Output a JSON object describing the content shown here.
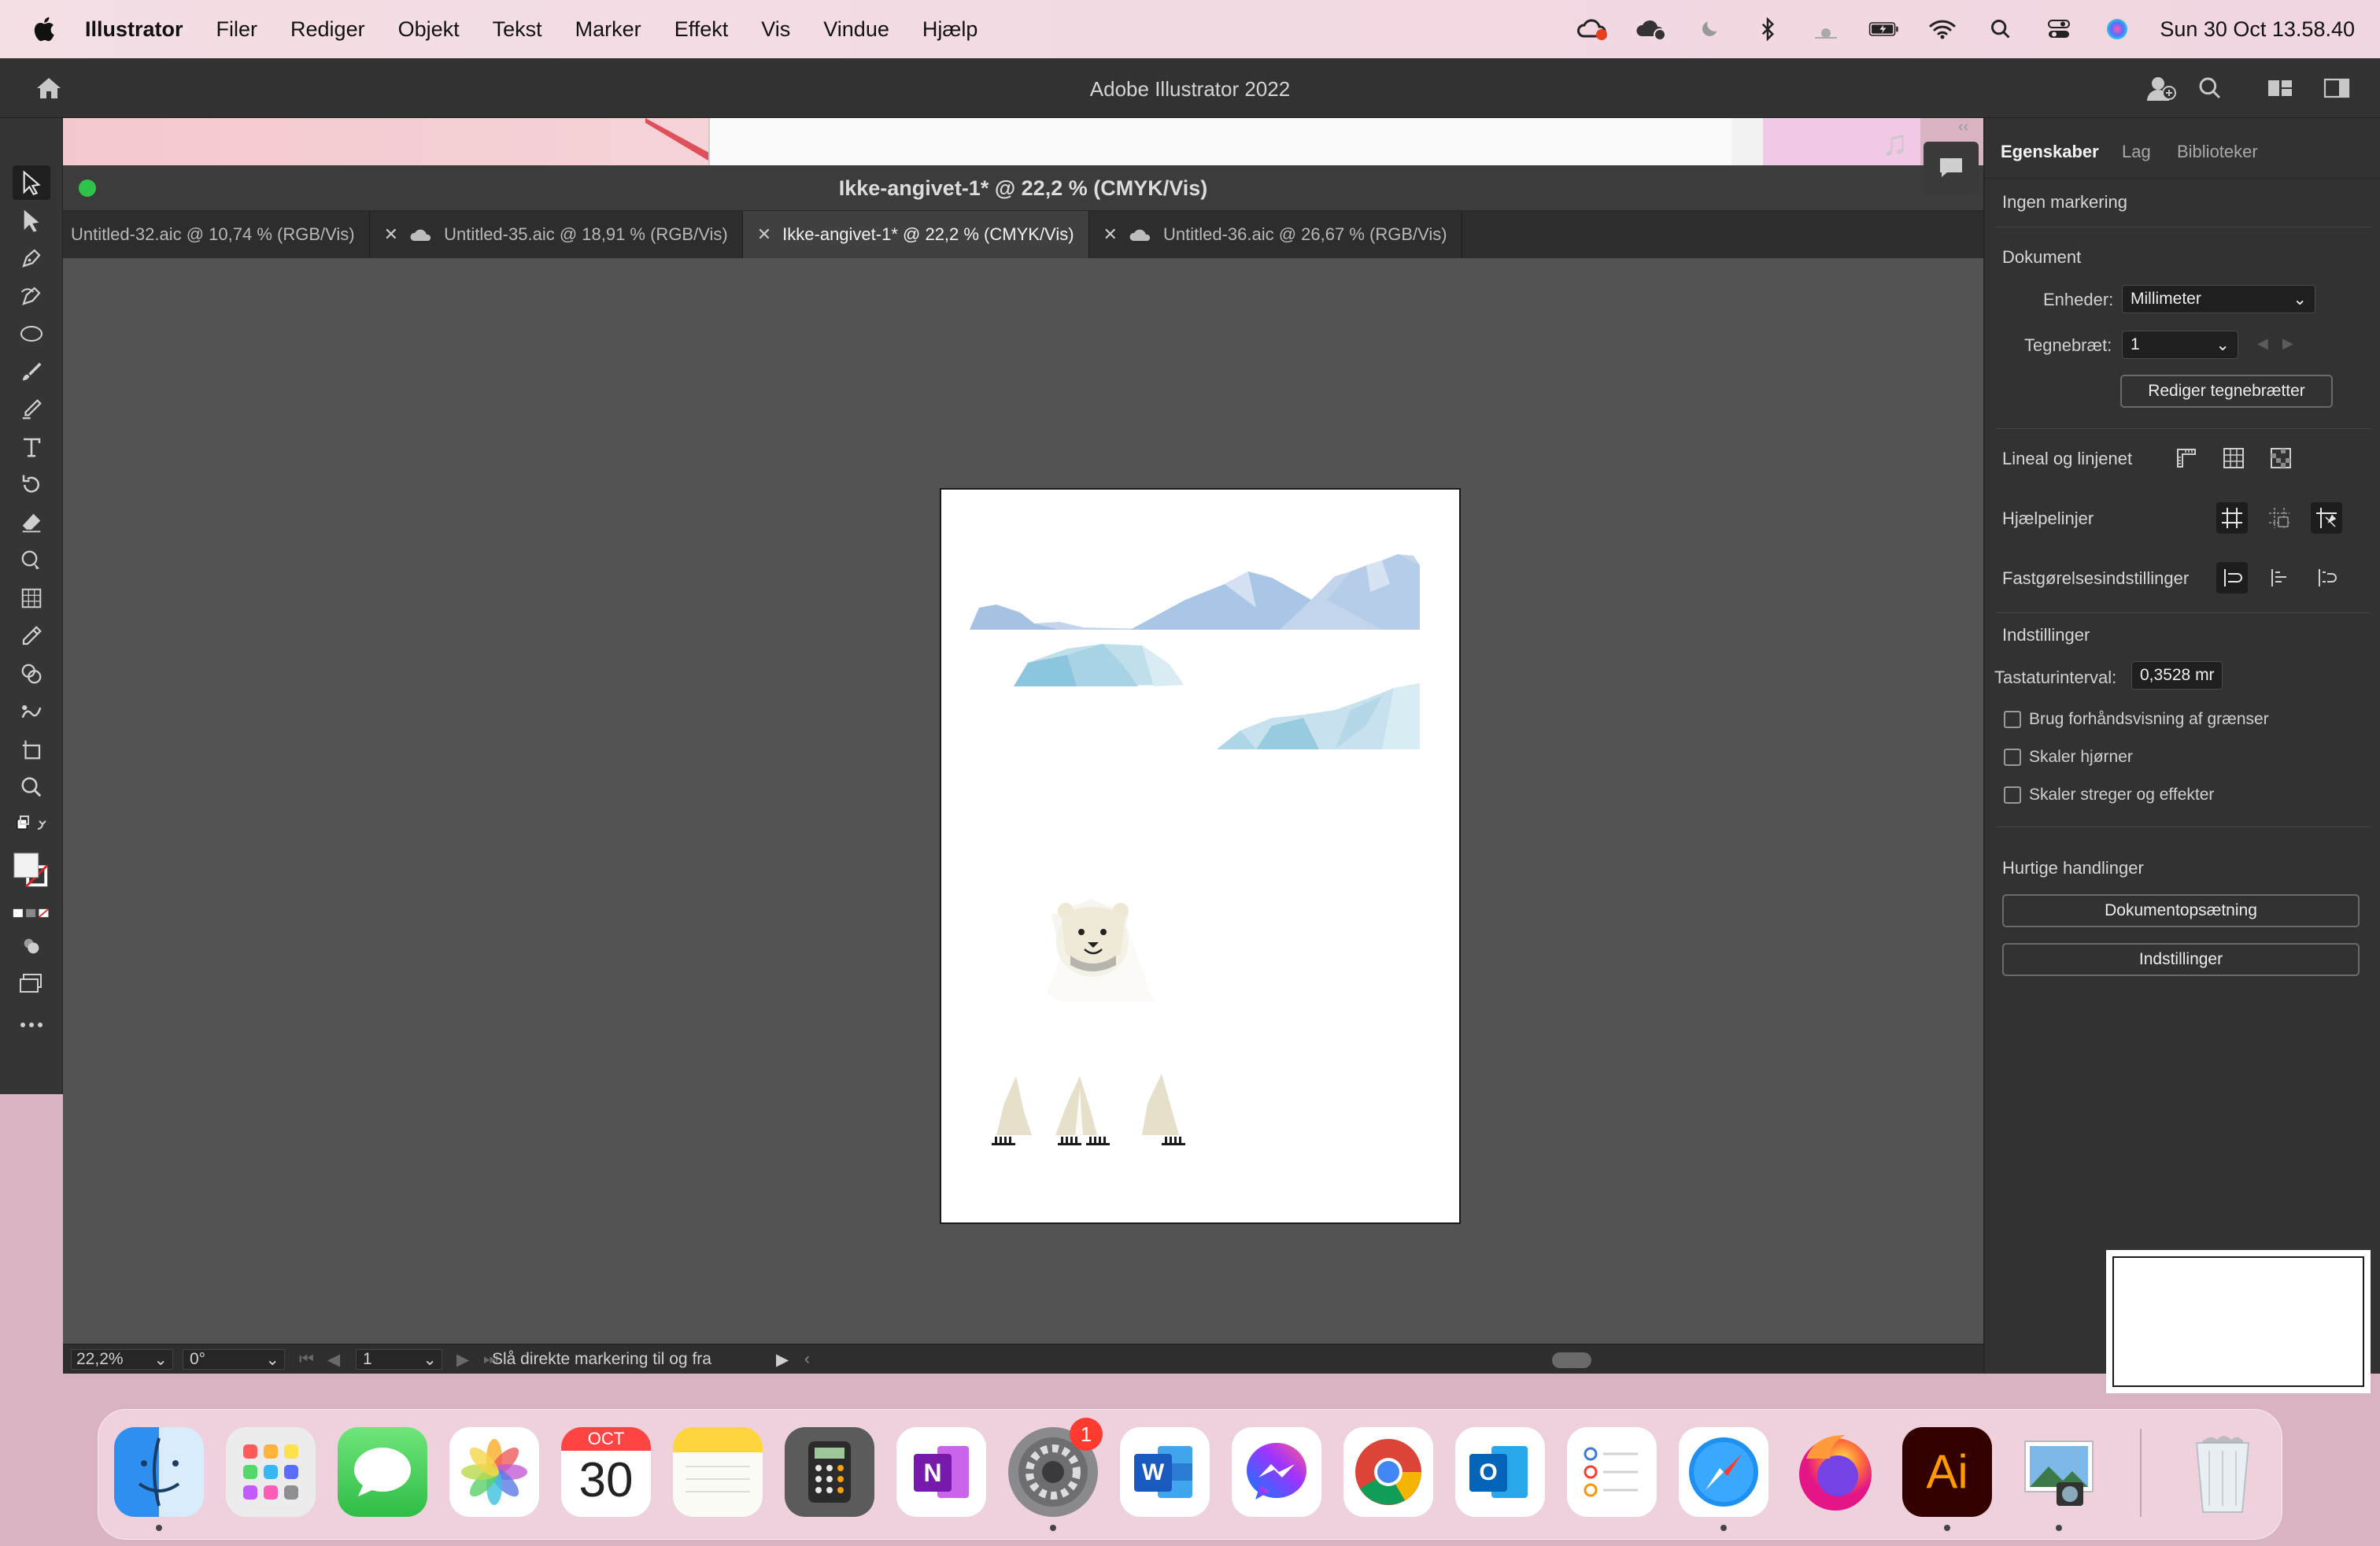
{
  "menubar": {
    "app_name": "Illustrator",
    "items": [
      "Filer",
      "Rediger",
      "Objekt",
      "Tekst",
      "Marker",
      "Effekt",
      "Vis",
      "Vindue",
      "Hjælp"
    ],
    "clock": "Sun 30 Oct  13.58.40"
  },
  "appbar": {
    "title": "Adobe Illustrator 2022"
  },
  "document": {
    "title": "Ikke-angivet-1* @ 22,2 % (CMYK/Vis)",
    "tabs": [
      {
        "label": "Untitled-32.aic @ 10,74 % (RGB/Vis)",
        "cloud": false,
        "active": false
      },
      {
        "label": "Untitled-35.aic @ 18,91 % (RGB/Vis)",
        "cloud": true,
        "active": false
      },
      {
        "label": "Ikke-angivet-1* @ 22,2 % (CMYK/Vis)",
        "cloud": false,
        "active": true
      },
      {
        "label": "Untitled-36.aic @ 26,67 % (RGB/Vis)",
        "cloud": true,
        "active": false
      }
    ]
  },
  "status": {
    "zoom": "22,2%",
    "rotation": "0°",
    "artboard": "1",
    "hint": "Slå direkte markering til og fra"
  },
  "panel": {
    "tabs": [
      "Egenskaber",
      "Lag",
      "Biblioteker"
    ],
    "no_selection": "Ingen markering",
    "document_header": "Dokument",
    "units_label": "Enheder:",
    "units_value": "Millimeter",
    "artboard_label": "Tegnebræt:",
    "artboard_value": "1",
    "edit_artboards": "Rediger tegnebrætter",
    "rulers_label": "Lineal og linjenet",
    "guides_label": "Hjælpelinjer",
    "snap_label": "Fastgørelsesindstillinger",
    "prefs_header": "Indstillinger",
    "keyboard_label": "Tastaturinterval:",
    "keyboard_value": "0,3528 mr",
    "checkboxes": [
      "Brug forhåndsvisning af grænser",
      "Skaler hjørner",
      "Skaler streger og effekter"
    ],
    "quick_header": "Hurtige handlinger",
    "btn_doc_setup": "Dokumentopsætning",
    "btn_prefs": "Indstillinger"
  },
  "dock": {
    "calendar_month": "OCT",
    "calendar_day": "30",
    "settings_badge": "1",
    "ai_label": "Ai",
    "onenote_label": "N",
    "word_label": "W",
    "outlook_label": "O",
    "apps": [
      "Finder",
      "Launchpad",
      "Messages",
      "Photos",
      "Calendar",
      "Notes",
      "Calculator",
      "OneNote",
      "System Preferences",
      "Word",
      "Messenger",
      "Chrome",
      "Outlook",
      "Reminders",
      "Safari",
      "Firefox",
      "Illustrator",
      "Preview",
      "Trash"
    ]
  },
  "colors": {
    "menubar_bg": "#f3dde4",
    "app_chrome": "#323232",
    "canvas": "#535353",
    "ice_blue": "#a9c8e6",
    "ice_cyan": "#9fd3e4",
    "bear_cream": "#e6dfc9"
  }
}
